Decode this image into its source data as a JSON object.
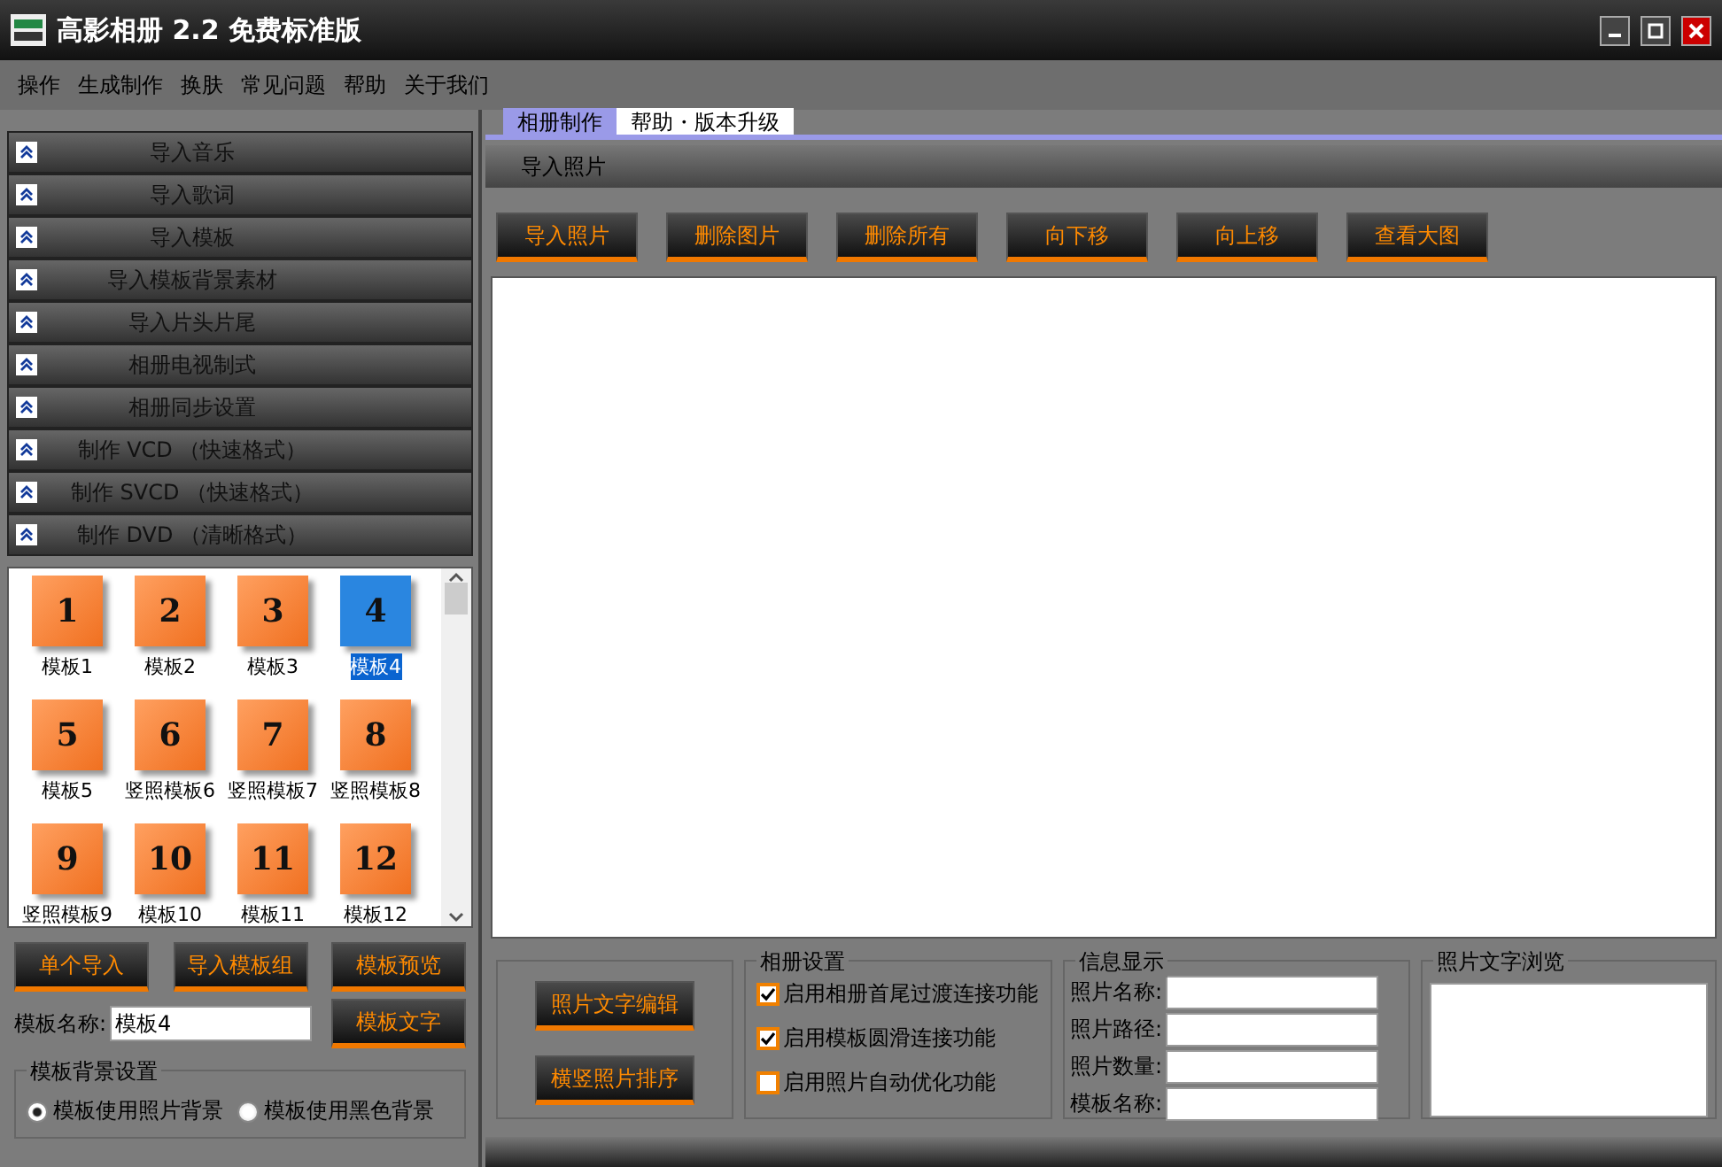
{
  "window": {
    "title": "高影相册 2.2 免费标准版"
  },
  "menu": [
    "操作",
    "生成制作",
    "换肤",
    "常见问题",
    "帮助",
    "关于我们"
  ],
  "sidebar": {
    "sections": [
      "导入音乐",
      "导入歌词",
      "导入模板",
      "导入模板背景素材",
      "导入片头片尾",
      "相册电视制式",
      "相册同步设置",
      "制作 VCD （快速格式）",
      "制作 SVCD （快速格式）",
      "制作 DVD （清晰格式）"
    ],
    "templates": [
      {
        "number": "1",
        "label": "模板1",
        "selected": false
      },
      {
        "number": "2",
        "label": "模板2",
        "selected": false
      },
      {
        "number": "3",
        "label": "模板3",
        "selected": false
      },
      {
        "number": "4",
        "label": "模板4",
        "selected": true
      },
      {
        "number": "5",
        "label": "模板5",
        "selected": false
      },
      {
        "number": "6",
        "label": "竖照模板6",
        "selected": false
      },
      {
        "number": "7",
        "label": "竖照模板7",
        "selected": false
      },
      {
        "number": "8",
        "label": "竖照模板8",
        "selected": false
      },
      {
        "number": "9",
        "label": "竖照模板9",
        "selected": false
      },
      {
        "number": "10",
        "label": "模板10",
        "selected": false
      },
      {
        "number": "11",
        "label": "模板11",
        "selected": false
      },
      {
        "number": "12",
        "label": "模板12",
        "selected": false
      }
    ],
    "buttons": [
      "单个导入",
      "导入模板组",
      "模板预览",
      "模板文字"
    ],
    "name_label": "模板名称:",
    "name_value": "模板4",
    "background_group": {
      "title": "模板背景设置",
      "options": [
        {
          "label": "模板使用照片背景",
          "selected": true
        },
        {
          "label": "模板使用黑色背景",
          "selected": false
        }
      ]
    }
  },
  "tabs": [
    {
      "label": "相册制作",
      "selected": true
    },
    {
      "label": "帮助・版本升级",
      "selected": false
    }
  ],
  "section_title": "导入照片",
  "toolbar": [
    "导入照片",
    "删除图片",
    "删除所有",
    "向下移",
    "向上移",
    "查看大图"
  ],
  "side_buttons": [
    "照片文字编辑",
    "横竖照片排序"
  ],
  "album_settings": {
    "title": "相册设置",
    "options": [
      {
        "label": "启用相册首尾过渡连接功能",
        "checked": true
      },
      {
        "label": "启用模板圆滑连接功能",
        "checked": true
      },
      {
        "label": "启用照片自动优化功能",
        "checked": false
      }
    ]
  },
  "info": {
    "title": "信息显示",
    "fields": [
      "照片名称:",
      "照片路径:",
      "照片数量:",
      "模板名称:"
    ]
  },
  "preview": {
    "title": "照片文字浏览"
  }
}
